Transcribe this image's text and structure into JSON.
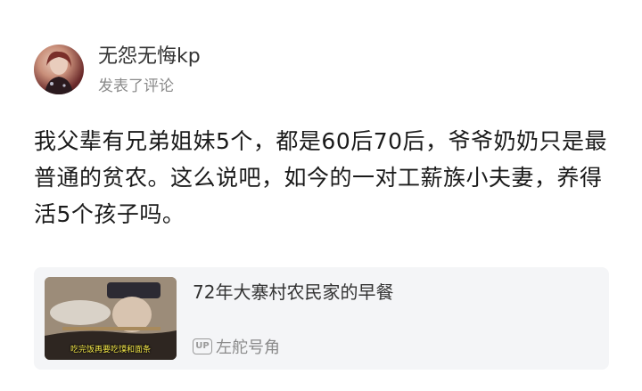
{
  "post": {
    "username": "无怨无悔kp",
    "action": "发表了评论",
    "text": "我父辈有兄弟姐妹5个，都是60后70后，爷爷奶奶只是最普通的贫农。这么说吧，如今的一对工薪族小夫妻，养得活5个孩子吗。"
  },
  "video_card": {
    "title": "72年大寨村农民家的早餐",
    "thumbnail_caption": "吃完饭再要吃馍和面条",
    "up_badge": "UP",
    "author": "左舵号角",
    "icon": "up-badge-icon"
  },
  "colors": {
    "card_background": "#f4f5f7",
    "text_primary": "#1a1a1a",
    "text_secondary": "#8a8a8a"
  }
}
